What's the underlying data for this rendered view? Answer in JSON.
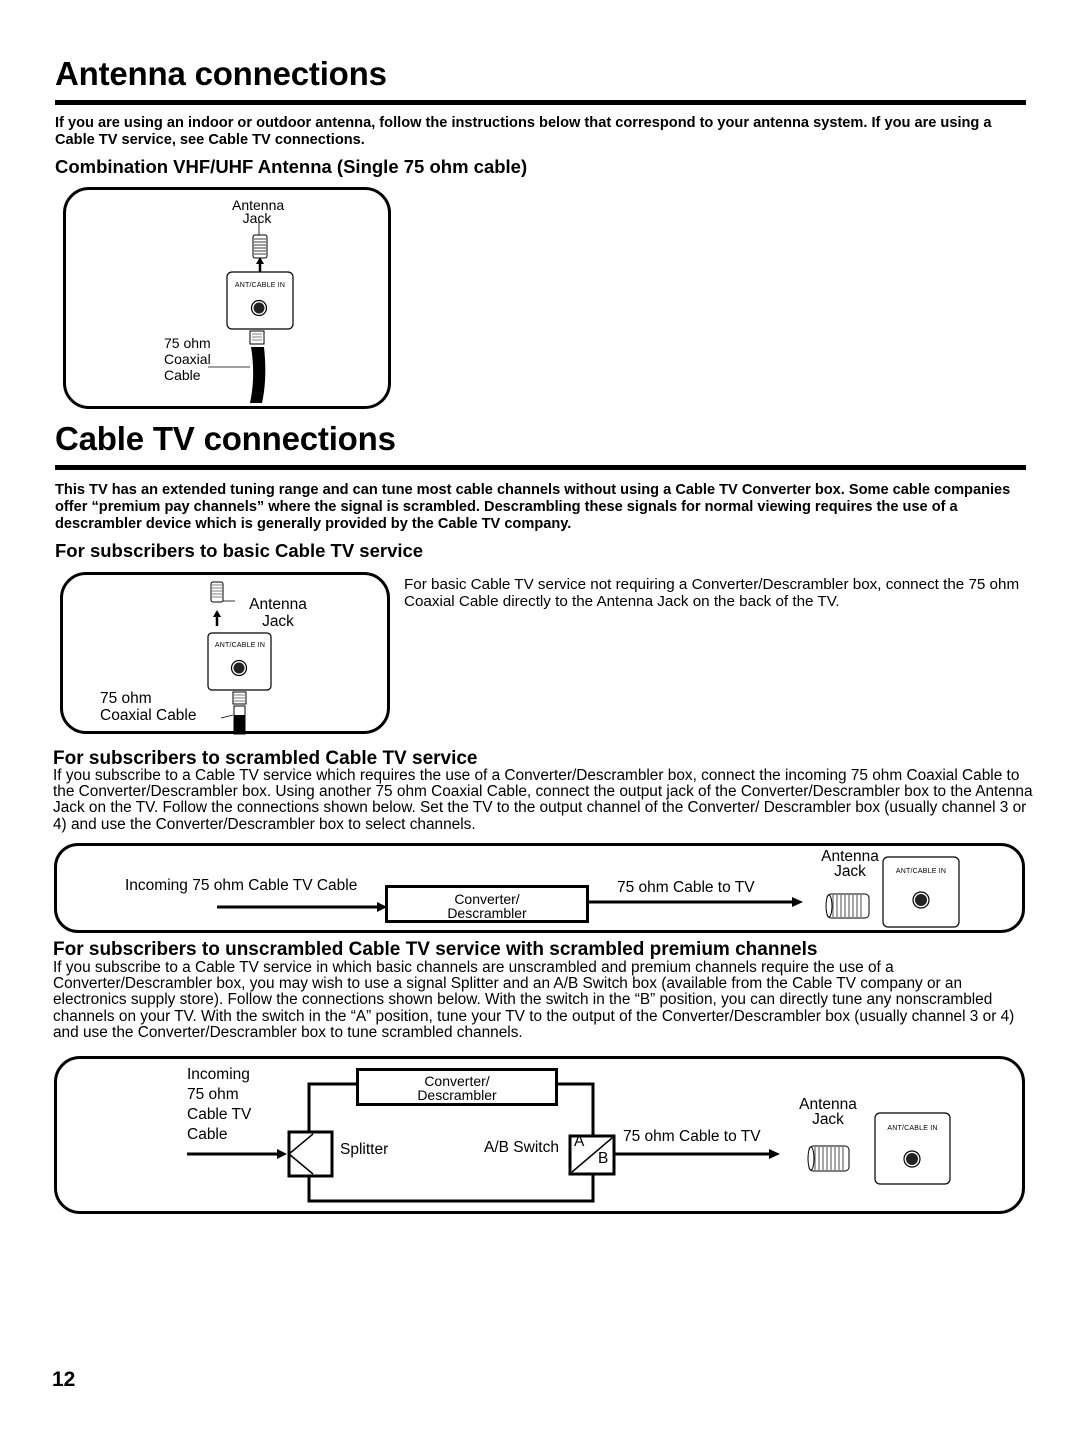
{
  "antenna_section": {
    "title": "Antenna connections",
    "intro": "If you are using an indoor or outdoor antenna, follow the instructions below that correspond to your antenna system. If you are using a Cable TV service, see Cable TV connections.",
    "subheading": "Combination VHF/UHF Antenna (Single 75 ohm cable)",
    "diagram": {
      "jack_label_line1": "Antenna",
      "jack_label_line2": "Jack",
      "panel_label": "ANT/CABLE IN",
      "cable_label_line1": "75 ohm",
      "cable_label_line2": "Coaxial",
      "cable_label_line3": "Cable"
    }
  },
  "cable_section": {
    "title": "Cable TV connections",
    "intro": "This TV has an extended tuning range and can tune most cable channels without using a Cable TV Converter box. Some cable companies offer “premium pay channels” where the signal is scrambled. Descrambling these signals for normal viewing requires the use of a descrambler device which is generally provided by the Cable TV company.",
    "basic": {
      "heading": "For subscribers to basic Cable TV service",
      "text": "For basic Cable TV service not requiring a Converter/Descrambler box, connect the 75 ohm Coaxial Cable directly to the Antenna Jack on the back of the TV.",
      "diagram": {
        "jack_label_line1": "Antenna",
        "jack_label_line2": "Jack",
        "panel_label": "ANT/CABLE IN",
        "cable_label_line1": "75 ohm",
        "cable_label_line2": "Coaxial Cable"
      }
    },
    "scrambled": {
      "heading": "For subscribers to scrambled Cable TV service",
      "text": "If you subscribe to a Cable TV service which requires the use of a Converter/Descrambler box, connect the incoming 75 ohm Coaxial Cable to the Converter/Descrambler box. Using another 75 ohm Coaxial Cable, connect the output jack of the Converter/Descrambler box to the Antenna Jack on the TV. Follow the connections shown below. Set the TV to the output channel of the Converter/ Descrambler box (usually channel 3 or 4) and use the Converter/Descrambler box to select channels.",
      "diagram": {
        "incoming_label": "Incoming 75 ohm Cable TV Cable",
        "converter_line1": "Converter/",
        "converter_line2": "Descrambler",
        "output_label": "75 ohm Cable to TV",
        "jack_label_line1": "Antenna",
        "jack_label_line2": "Jack",
        "panel_label": "ANT/CABLE IN"
      }
    },
    "unscrambled": {
      "heading": "For subscribers to unscrambled Cable TV service with scrambled premium channels",
      "text": "If you subscribe to a Cable TV service in which basic channels are unscrambled and premium channels require the use of a Converter/Descrambler box, you may wish to use a signal Splitter and an A/B Switch box (available from the Cable TV company or an electronics supply store). Follow the connections shown below. With the switch in the “B” position, you can directly tune any nonscrambled channels on your TV. With the switch in the “A” position, tune your TV to the output of the Converter/Descrambler box (usually channel 3 or 4) and use the Converter/Descrambler box to tune scrambled channels.",
      "diagram": {
        "incoming_line1": "Incoming",
        "incoming_line2": "75 ohm",
        "incoming_line3": "Cable TV",
        "incoming_line4": "Cable",
        "converter_line1": "Converter/",
        "converter_line2": "Descrambler",
        "splitter_label": "Splitter",
        "switch_label": "A/B Switch",
        "switch_a": "A",
        "switch_b": "B",
        "output_label": "75 ohm Cable to TV",
        "jack_label_line1": "Antenna",
        "jack_label_line2": "Jack",
        "panel_label": "ANT/CABLE IN"
      }
    }
  },
  "page_number": "12"
}
